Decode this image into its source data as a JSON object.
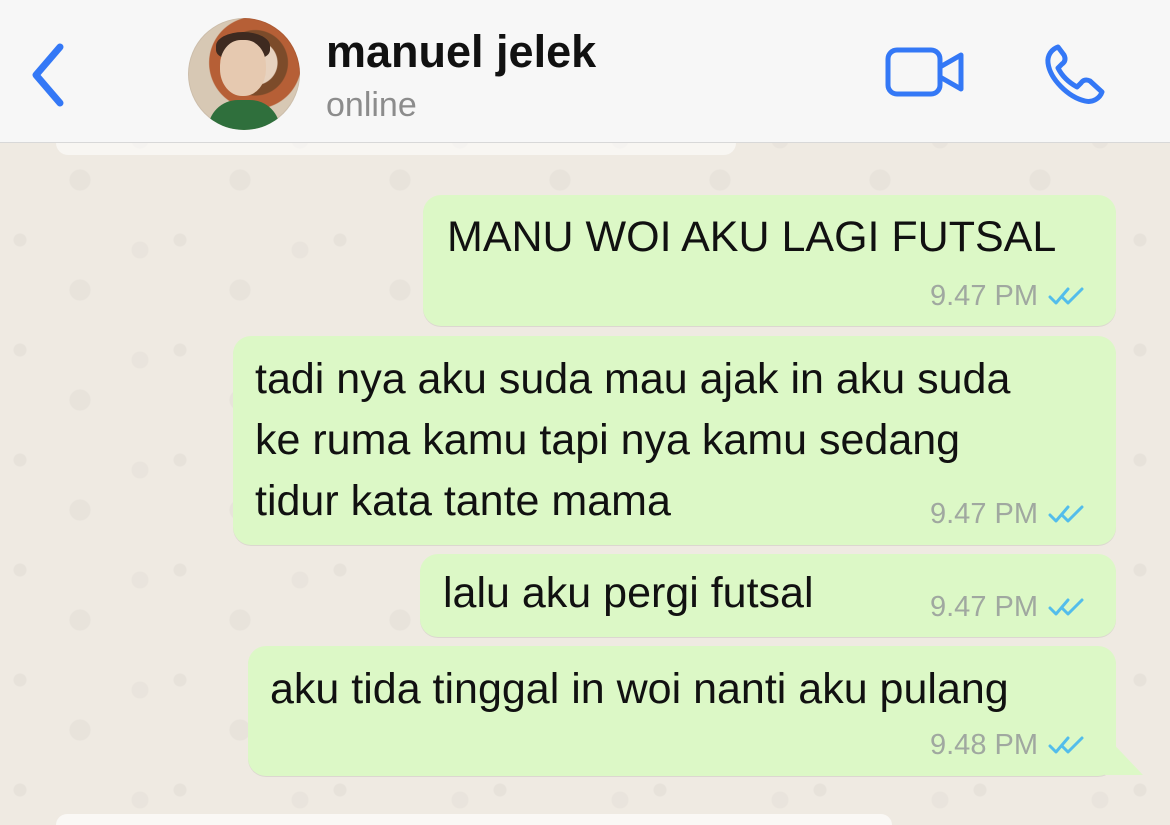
{
  "header": {
    "name": "manuel jelek",
    "status": "online",
    "back_icon": "chevron-left-icon",
    "video_icon": "video-camera-icon",
    "call_icon": "phone-icon",
    "accent": "#3478f6"
  },
  "messages": [
    {
      "text": "MANU WOI AKU LAGI FUTSAL",
      "time": "9.47 PM",
      "status_icon": "double-check-icon"
    },
    {
      "text": "tadi nya aku suda mau ajak in aku suda\nke ruma kamu tapi nya kamu sedang\ntidur kata tante mama",
      "time": "9.47 PM",
      "status_icon": "double-check-icon"
    },
    {
      "text": "lalu aku pergi futsal",
      "time": "9.47 PM",
      "status_icon": "double-check-icon"
    },
    {
      "text": "aku tida tinggal in woi nanti aku pulang",
      "time": "9.48 PM",
      "status_icon": "double-check-icon"
    }
  ],
  "colors": {
    "bubble": "#dcf8c6",
    "chat_background": "#efeae2",
    "header_background": "#f7f7f7",
    "read_check": "#53bdeb"
  }
}
